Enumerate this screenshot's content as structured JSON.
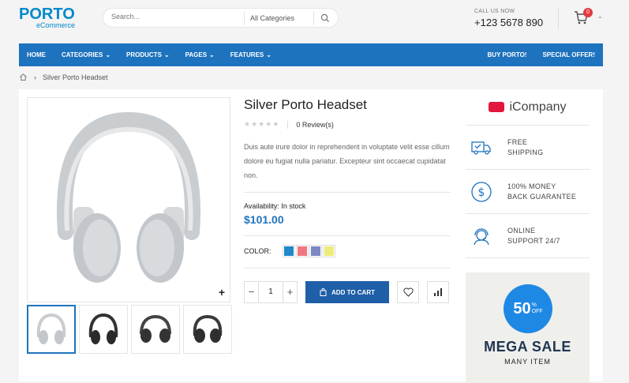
{
  "header": {
    "logo_text": "PORTO",
    "logo_sub": "eCommerce",
    "search_placeholder": "Search...",
    "category_select": "All Categories",
    "call_label": "CALL US NOW",
    "phone": "+123 5678 890",
    "cart_count": "0"
  },
  "nav": {
    "items": [
      {
        "label": "HOME"
      },
      {
        "label": "CATEGORIES"
      },
      {
        "label": "PRODUCTS"
      },
      {
        "label": "PAGES"
      },
      {
        "label": "FEATURES"
      }
    ],
    "right_items": [
      {
        "label": "BUY PORTO!"
      },
      {
        "label": "SPECIAL OFFER!"
      }
    ]
  },
  "breadcrumb": {
    "current": "Silver Porto Headset"
  },
  "product": {
    "title": "Silver Porto Headset",
    "rating_stars": "★★★★★",
    "reviews": "0 Review(s)",
    "description": "Duis aute irure dolor in reprehenderit in voluptate velit esse cillum dolore eu fugiat nulla pariatur. Excepteur sint occaecat cupidatat non.",
    "availability_label": "Availability:",
    "availability_value": "In stock",
    "price": "$101.00",
    "color_label": "COLOR:",
    "colors": [
      "#1e88c8",
      "#f0777f",
      "#7c88c4",
      "#eeeb7a"
    ],
    "quantity": "1",
    "add_to_cart": "ADD TO CART"
  },
  "sidebar": {
    "company": "iCompany",
    "features": [
      {
        "line1": "FREE",
        "line2": "SHIPPING",
        "icon": "truck-icon"
      },
      {
        "line1": "100% MONEY",
        "line2": "BACK GUARANTEE",
        "icon": "dollar-icon"
      },
      {
        "line1": "ONLINE",
        "line2": "SUPPORT 24/7",
        "icon": "support-icon"
      }
    ],
    "banner": {
      "percent": "50",
      "pct_sign": "%",
      "off": "OFF",
      "title": "MEGA SALE",
      "subtitle": "MANY ITEM"
    }
  },
  "colors": {
    "brand": "#1e73be",
    "price": "#1e73be",
    "badge": "#e13b3f"
  }
}
